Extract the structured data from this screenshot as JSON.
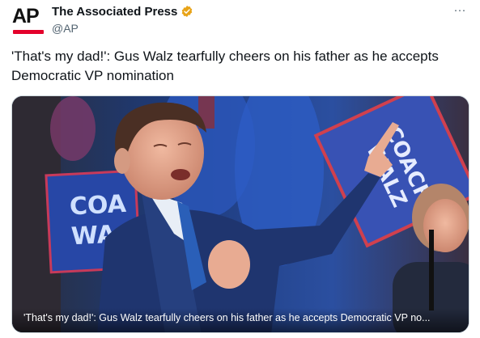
{
  "account": {
    "avatar_text": "AP",
    "name": "The Associated Press",
    "handle": "@AP",
    "verified": true,
    "verified_color": "#e8a317",
    "brand_red": "#e4002b"
  },
  "menu": {
    "more_label": "···"
  },
  "tweet": {
    "text": "'That's my dad!': Gus Walz tearfully cheers on his father as he accepts Democratic VP nomination"
  },
  "media": {
    "caption": "'That's my dad!': Gus Walz tearfully cheers on his father as he accepts Democratic VP no...",
    "sign_left_text": "COA WA",
    "sign_right_text": "COACH WALZ"
  }
}
